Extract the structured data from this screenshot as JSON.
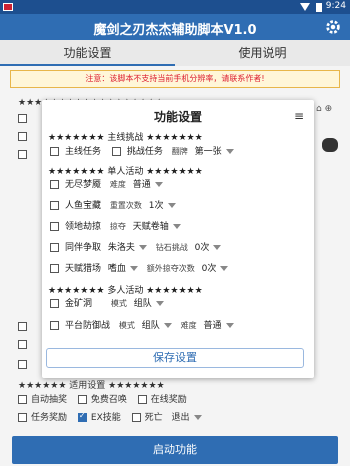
{
  "status_bar": {
    "time": "9:24"
  },
  "app_bar": {
    "title": "魔剑之刃杰杰辅助脚本V1.0"
  },
  "tabs": [
    {
      "label": "功能设置",
      "active": true
    },
    {
      "label": "使用说明",
      "active": false
    }
  ],
  "notice": "注意：该脚本不支持当前手机分辨率，请联系作者!",
  "background_rows": [
    {
      "text": "★★★★★★★★★★★★★★★★★★"
    },
    {
      "text": "一键设置"
    },
    {
      "text": "★★★★★★ 适用设置 ★★★★★★★"
    }
  ],
  "bottom_options": {
    "row1": [
      "自动抽奖",
      "免费召唤",
      "在线奖励"
    ],
    "row2": [
      "任务奖励",
      "EX技能",
      "死亡"
    ],
    "death_select": "退出"
  },
  "start_button": "启动功能",
  "dialog": {
    "title": "功能设置",
    "sections": [
      "★★★★★★★ 主线挑战 ★★★★★★★",
      "★★★★★★★ 单人活动 ★★★★★★★",
      "★★★★★★★ 多人活动 ★★★★★★★"
    ],
    "main_task": {
      "task_label": "主线任务",
      "challenge_label": "挑战任务",
      "flip_label": "翻牌",
      "flip_value": "第一张"
    },
    "wujin": {
      "label": "无尽梦魇",
      "diff_label": "难度",
      "diff_value": "普通"
    },
    "mermaid": {
      "label": "人鱼宝藏",
      "reset_label": "重置次数",
      "reset_value": "1次"
    },
    "territory": {
      "label": "领地劫掠",
      "plunder_label": "掠夺",
      "plunder_value": "天赋卷轴"
    },
    "contest": {
      "label": "同伴争取",
      "select_value": "朱洛夫",
      "diamond_label": "钻石挑战",
      "diamond_value": "0次"
    },
    "talent": {
      "label": "天赋猎场",
      "select_value": "嗜血",
      "extra_label": "额外掠夺次数",
      "extra_value": "0次"
    },
    "gold": {
      "label": "金矿洞",
      "mode_label": "模式",
      "mode_value": "组队"
    },
    "defense": {
      "label": "平台防御战",
      "mode_label": "模式",
      "mode_value": "组队",
      "diff_label": "难度",
      "diff_value": "普通"
    },
    "save_label": "保存设置"
  }
}
